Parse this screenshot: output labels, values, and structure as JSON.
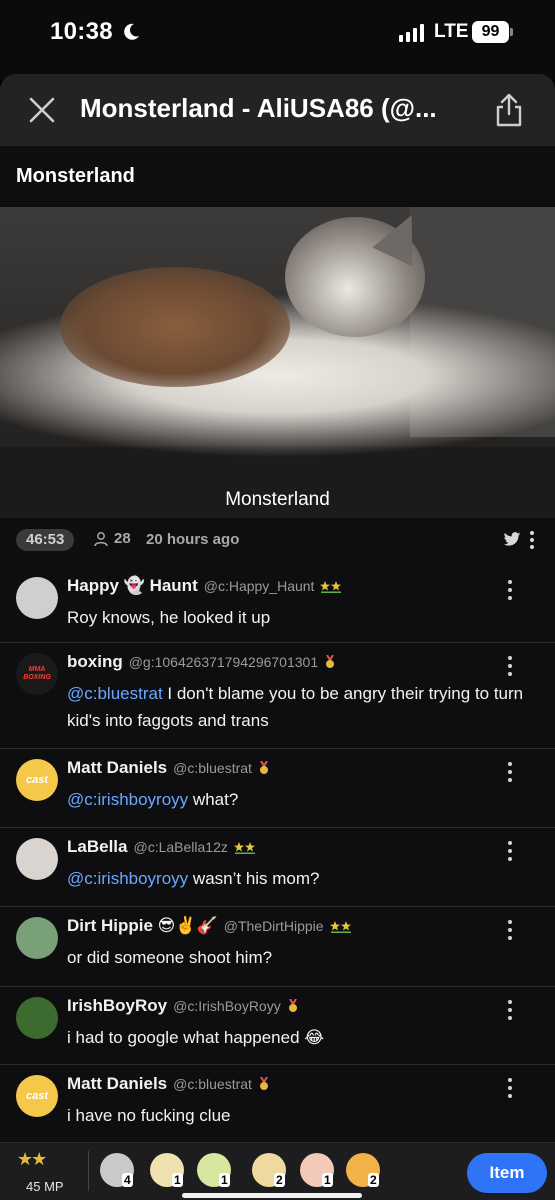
{
  "status_bar": {
    "time": "10:38",
    "network": "LTE",
    "battery": "99"
  },
  "header": {
    "title": "Monsterland - AliUSA86 (@..."
  },
  "section_title": "Monsterland",
  "video": {
    "caption": "Monsterland"
  },
  "meta": {
    "duration": "46:53",
    "viewers": "28",
    "time_ago": "20 hours ago"
  },
  "comments": [
    {
      "name": "Happy 👻 Haunt",
      "handle": "@c:Happy_Haunt",
      "badge": "gold-double",
      "text": "Roy knows, he looked it up",
      "avatar_color": "#cfcfcf"
    },
    {
      "name": "boxing",
      "handle": "@g:1064263717942967013​01",
      "badge": "medal",
      "mention": "@c:bluestrat",
      "text": " I don't blame you to be angry their trying to turn kid's into faggots and trans",
      "avatar_color": "#1a1a1a",
      "avatar_label": "MMA BOXING"
    },
    {
      "name": "Matt Daniels",
      "handle": "@c:bluestrat",
      "badge": "medal",
      "mention": "@c:irishboyroyy",
      "text": " what?",
      "avatar_color": "#f5c84a",
      "avatar_label": "cast"
    },
    {
      "name": "LaBella",
      "handle": "@c:LaBella12z",
      "badge": "gold-double",
      "mention": "@c:irishboyroyy",
      "text": " wasn’t his mom?",
      "avatar_color": "#d9d4cf"
    },
    {
      "name": "Dirt Hippie 😎✌️🎸",
      "handle": "@TheDirtHippie",
      "badge": "gold-double",
      "text": "or did someone shoot him?",
      "avatar_color": "#7aa07a"
    },
    {
      "name": "IrishBoyRoy",
      "handle": "@c:IrishBoyRoyy",
      "badge": "medal",
      "text": "i had to google what happened 😂",
      "avatar_color": "#3b6b2f"
    },
    {
      "name": "Matt Daniels",
      "handle": "@c:bluestrat",
      "badge": "medal",
      "text": "i have no fucking clue",
      "avatar_color": "#f5c84a",
      "avatar_label": "cast"
    }
  ],
  "bottom_bar": {
    "stars": "★★",
    "mp": "45 MP",
    "gifts": [
      {
        "count": "4",
        "color": "#c9c9c9"
      },
      {
        "count": "1",
        "color": "#efe2b0"
      },
      {
        "count": "1",
        "color": "#d7e7a0"
      },
      {
        "count": "2",
        "color": "#f0d9a0"
      },
      {
        "count": "1",
        "color": "#f3c9b8"
      },
      {
        "count": "2",
        "color": "#f2b24a"
      }
    ],
    "item_button": "Item"
  }
}
